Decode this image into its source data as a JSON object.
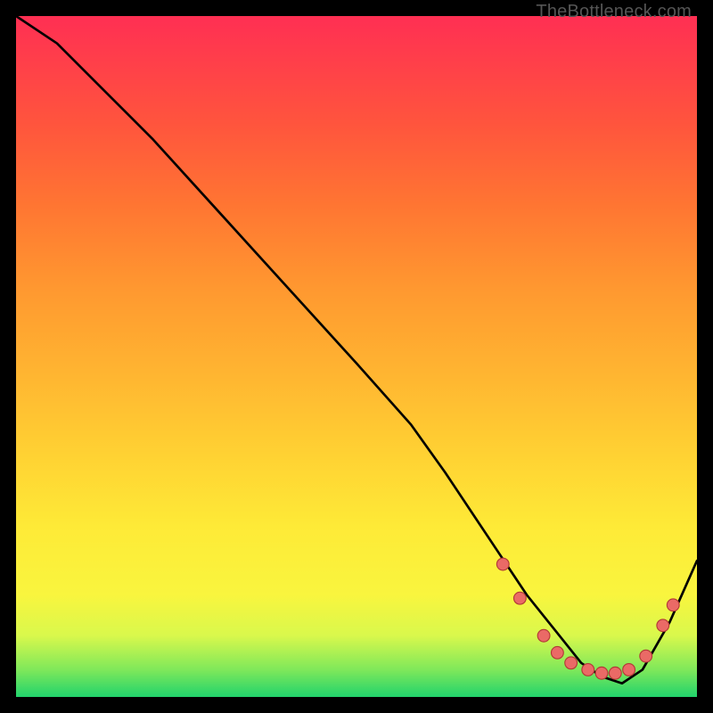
{
  "watermark": "TheBottleneck.com",
  "colors": {
    "curve": "#000000",
    "dot_fill": "#ea6a66",
    "dot_stroke": "#b23a36",
    "bg": "#000000"
  },
  "chart_data": {
    "type": "line",
    "title": "",
    "xlabel": "",
    "ylabel": "",
    "xlim": [
      0,
      100
    ],
    "ylim": [
      0,
      100
    ],
    "series": [
      {
        "name": "curve",
        "x": [
          0,
          6,
          12,
          20,
          30,
          40,
          50,
          58,
          63,
          67,
          71,
          75,
          79,
          83,
          86,
          89,
          92,
          96,
          100
        ],
        "y": [
          100,
          96,
          90,
          82,
          71,
          60,
          49,
          40,
          33,
          27,
          21,
          15,
          10,
          5,
          3,
          2,
          4,
          11,
          20
        ]
      }
    ],
    "markers": [
      {
        "x": 71.5,
        "y": 19.5
      },
      {
        "x": 74.0,
        "y": 14.5
      },
      {
        "x": 77.5,
        "y": 9.0
      },
      {
        "x": 79.5,
        "y": 6.5
      },
      {
        "x": 81.5,
        "y": 5.0
      },
      {
        "x": 84.0,
        "y": 4.0
      },
      {
        "x": 86.0,
        "y": 3.5
      },
      {
        "x": 88.0,
        "y": 3.5
      },
      {
        "x": 90.0,
        "y": 4.0
      },
      {
        "x": 92.5,
        "y": 6.0
      },
      {
        "x": 95.0,
        "y": 10.5
      },
      {
        "x": 96.5,
        "y": 13.5
      }
    ]
  }
}
